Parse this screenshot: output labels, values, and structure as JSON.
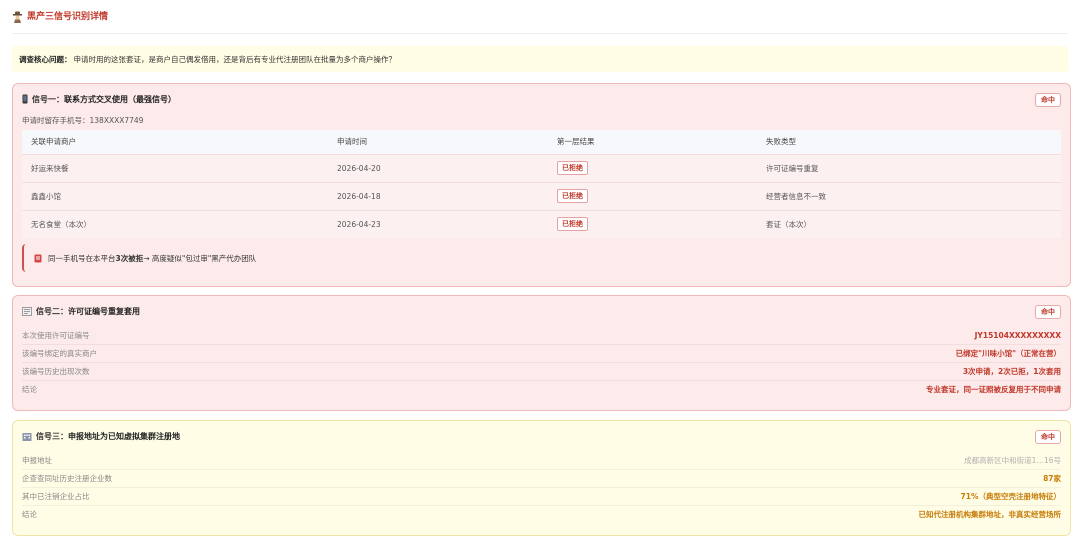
{
  "header": {
    "title": "黑产三信号识别详情",
    "icon": "detective-icon"
  },
  "core_question": {
    "label": "调查核心问题：",
    "text": "申请时用的这张套证，是商户自己偶发借用，还是背后有专业代注册团队在批量为多个商户操作？"
  },
  "signal1": {
    "title": "联系方式交叉使用（最强信号）",
    "badge": "命中",
    "phone_label": "申请时留存手机号：138XXXX7749",
    "table": {
      "headers": [
        "关联申请商户",
        "申请时间",
        "第一层结果",
        "失败类型"
      ],
      "rows": [
        {
          "merchant": "好运来快餐",
          "date": "2026-04-20",
          "result": "已拒绝",
          "fail_type": "许可证编号重复"
        },
        {
          "merchant": "鑫鑫小馆",
          "date": "2026-04-18",
          "result": "已拒绝",
          "fail_type": "经营者信息不一致"
        },
        {
          "merchant": "无名食堂（本次）",
          "date": "2026-04-23",
          "result": "已拒绝",
          "fail_type": "套证（本次）"
        }
      ]
    },
    "callout": {
      "prefix": "同一手机号在本平台 ",
      "bold": "3次被拒",
      "suffix": " → 高度疑似\"包过审\"黑产代办团队"
    }
  },
  "signal2": {
    "title": "许可证编号重复套用",
    "badge": "命中",
    "rows": [
      {
        "key": "本次使用许可证编号",
        "value": "JY15104XXXXXXXXX"
      },
      {
        "key": "该编号绑定的真实商户",
        "value": "已绑定\"川味小馆\"（正常在营）"
      },
      {
        "key": "该编号历史出现次数",
        "value": "3次申请，2次已拒，1次套用"
      },
      {
        "key": "结论",
        "value": "专业套证，同一证照被反复用于不同申请"
      }
    ]
  },
  "signal3": {
    "title": "申报地址为已知虚拟集群注册地",
    "badge": "命中",
    "rows": [
      {
        "key": "申报地址",
        "value": "成都高新区中和街道1…16号"
      },
      {
        "key": "企查查同址历史注册企业数",
        "value": "87家"
      },
      {
        "key": "其中已注销企业占比",
        "value": "71%（典型空壳注册地特征）"
      },
      {
        "key": "结论",
        "value": "已知代注册机构集群地址，非真实经营场所"
      }
    ]
  },
  "colors": {
    "accent_red": "#c0392b",
    "accent_orange": "#c77d0a",
    "red_card_bg": "#fdeaea",
    "yellow_card_bg": "#fffde6"
  }
}
